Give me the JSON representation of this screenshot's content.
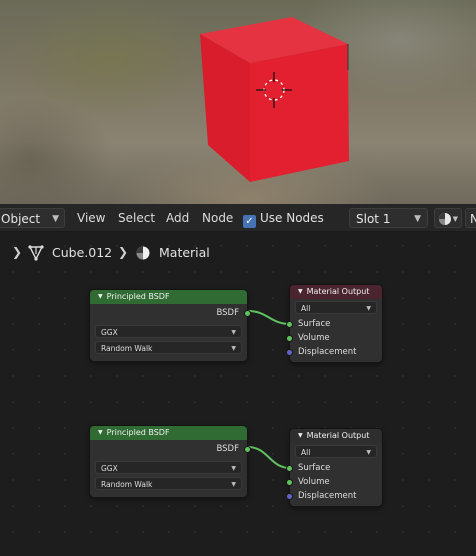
{
  "viewport": {
    "colors": {
      "cube_front": "#e01e2e",
      "cube_side": "#c11827",
      "cube_top": "#e23341"
    }
  },
  "header": {
    "mode_dropdown": "Object",
    "menus": [
      "View",
      "Select",
      "Add",
      "Node"
    ],
    "use_nodes": {
      "label": "Use Nodes",
      "checked": true
    },
    "slot_dropdown": "Slot 1",
    "shading_icon": "material-sphere-icon",
    "extra_label": "N"
  },
  "breadcrumb": {
    "object": "Cube.012",
    "material": "Material"
  },
  "nodes": [
    {
      "title": "Principled BSDF",
      "output": "BSDF",
      "distribution": "GGX",
      "subsurface": "Random Walk"
    },
    {
      "title": "Material Output",
      "target": "All",
      "inputs": [
        "Surface",
        "Volume",
        "Displacement"
      ]
    },
    {
      "title": "Principled BSDF",
      "output": "BSDF",
      "distribution": "GGX",
      "subsurface": "Random Walk"
    },
    {
      "title": "Material Output",
      "target": "All",
      "inputs": [
        "Surface",
        "Volume",
        "Displacement"
      ]
    }
  ],
  "colors": {
    "accent": "#4772b3",
    "bsdf_header": "#2f6b32",
    "output_header_active": "#4a2530",
    "link": "#5fc15f"
  }
}
